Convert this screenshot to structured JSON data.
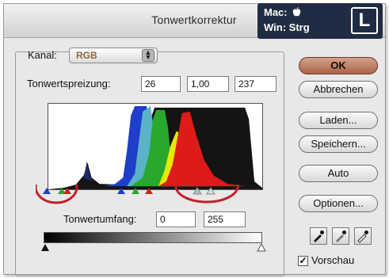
{
  "window": {
    "title": "Tonwertkorrektur"
  },
  "shortcut": {
    "mac": "Mac:",
    "win": "Win:",
    "win_key": "Strg",
    "key": "L",
    "mac_icon": "apple-icon"
  },
  "kanal": {
    "label": "Kanal:",
    "value": "RGB"
  },
  "input_levels": {
    "label": "Tonwertspreizung:",
    "black": "26",
    "gamma": "1,00",
    "white": "237"
  },
  "output_levels": {
    "label": "Tonwertumfang:",
    "black": "0",
    "white": "255"
  },
  "buttons": {
    "ok": "OK",
    "cancel": "Abbrechen",
    "load": "Laden...",
    "save": "Speichern...",
    "auto": "Auto",
    "options": "Optionen..."
  },
  "preview": {
    "label": "Vorschau",
    "checked": true
  },
  "colors": {
    "ok_button": "#b06a50",
    "highlight_circle": "#c0202c",
    "overlay_bg": "#1f2c44"
  }
}
